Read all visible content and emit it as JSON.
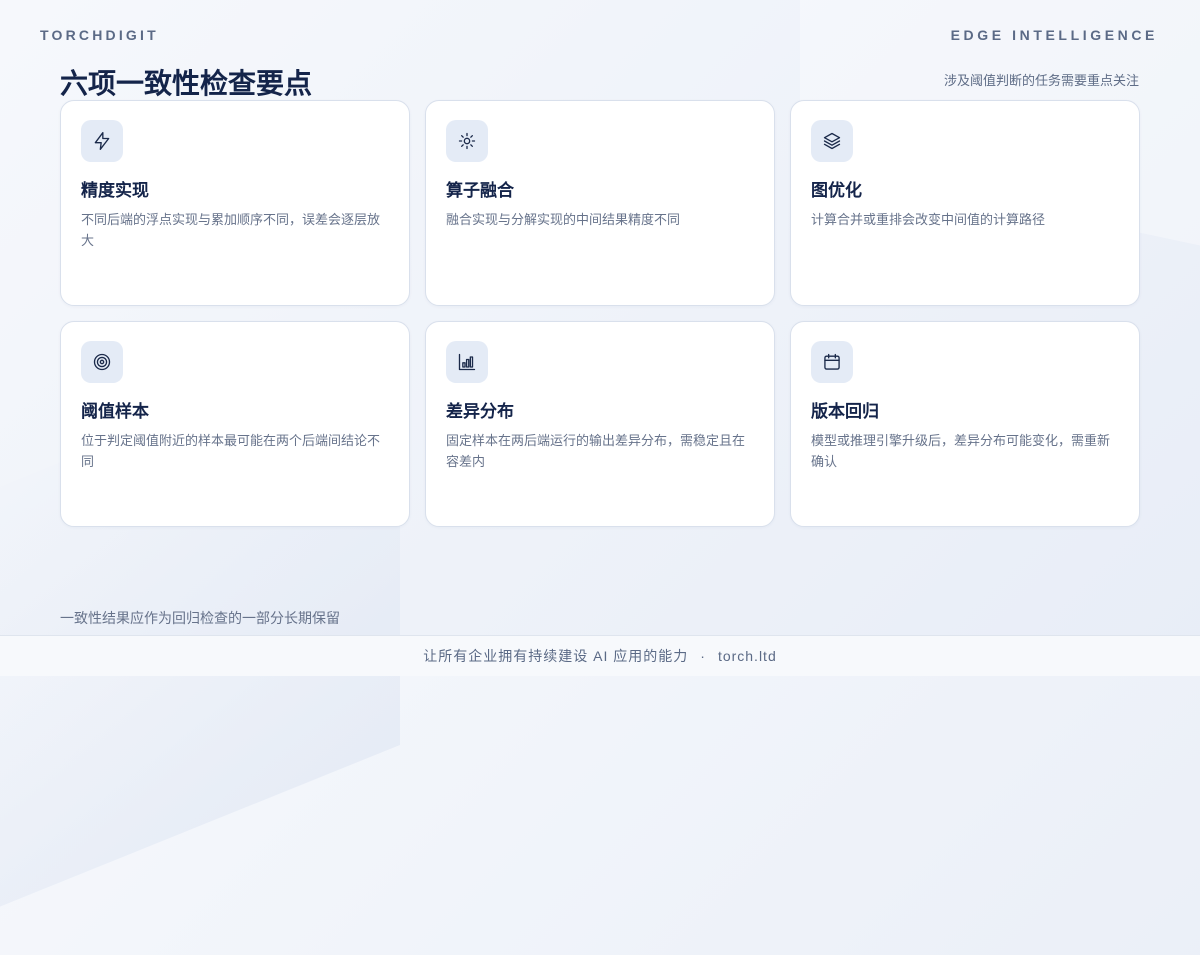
{
  "header": {
    "brand_left": "TORCHDIGIT",
    "brand_right": "EDGE INTELLIGENCE"
  },
  "page": {
    "title": "六项一致性检查要点",
    "subtitle": "涉及阈值判断的任务需要重点关注"
  },
  "cards": [
    {
      "icon": "lightning-icon",
      "title": "精度实现",
      "desc": "不同后端的浮点实现与累加顺序不同，误差会逐层放大"
    },
    {
      "icon": "sun-icon",
      "title": "算子融合",
      "desc": "融合实现与分解实现的中间结果精度不同"
    },
    {
      "icon": "layers-icon",
      "title": "图优化",
      "desc": "计算合并或重排会改变中间值的计算路径"
    },
    {
      "icon": "target-icon",
      "title": "阈值样本",
      "desc": "位于判定阈值附近的样本最可能在两个后端间结论不同"
    },
    {
      "icon": "bar-chart-icon",
      "title": "差异分布",
      "desc": "固定样本在两后端运行的输出差异分布，需稳定且在容差内"
    },
    {
      "icon": "calendar-icon",
      "title": "版本回归",
      "desc": "模型或推理引擎升级后，差异分布可能变化，需重新确认"
    }
  ],
  "footnote": "一致性结果应作为回归检查的一部分长期保留",
  "footer": {
    "slogan": "让所有企业拥有持续建设 AI 应用的能力",
    "separator": "·",
    "site": "torch.ltd"
  },
  "colors": {
    "title": "#14244a",
    "muted": "#67738b",
    "icon_bg": "#e4ebf6"
  }
}
